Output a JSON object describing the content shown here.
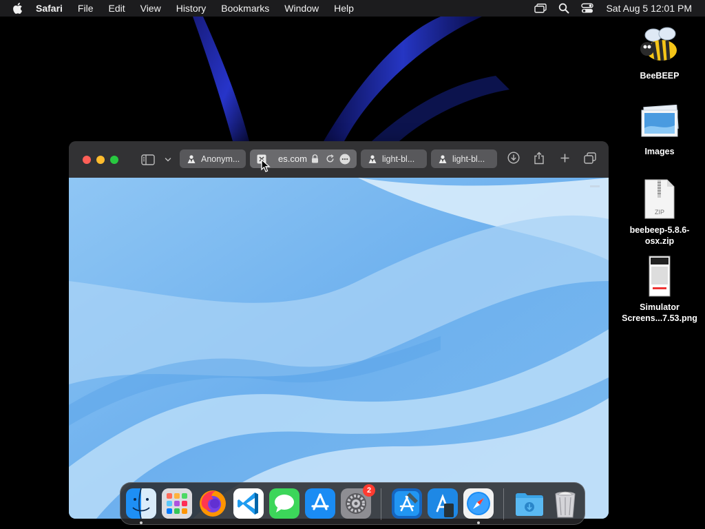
{
  "menubar": {
    "apple_icon": "apple-logo-icon",
    "app_name": "Safari",
    "items": [
      "File",
      "Edit",
      "View",
      "History",
      "Bookmarks",
      "Window",
      "Help"
    ],
    "status_icons": [
      "screen-mirroring-icon",
      "spotlight-search-icon",
      "control-center-icon"
    ],
    "clock": "Sat Aug 5  12:01 PM"
  },
  "desktop": {
    "icons": [
      {
        "label": "BeeBEEP",
        "icon": "bee-app-icon"
      },
      {
        "label": "Images",
        "icon": "image-folder-icon"
      },
      {
        "label_line1": "beebeep-5.8.6-",
        "label_line2": "osx.zip",
        "icon": "zip-file-icon",
        "type_text": "ZIP"
      },
      {
        "label_line1": "Simulator",
        "label_line2": "Screens...7.53.png",
        "icon": "png-file-icon"
      }
    ]
  },
  "safari": {
    "tabs": [
      {
        "label": "Anonym...",
        "icon": "favicon-person-icon",
        "active": false
      },
      {
        "label": "es.com",
        "icon": "close-tab-icon",
        "active": true
      },
      {
        "label": "light-bl...",
        "icon": "favicon-person-icon",
        "active": false
      },
      {
        "label": "light-bl...",
        "icon": "favicon-person-icon",
        "active": false
      }
    ],
    "toolbar_icons": [
      "sidebar-toggle-icon",
      "chevron-down-icon",
      "download-icon",
      "share-icon",
      "new-tab-icon",
      "tab-overview-icon"
    ],
    "page_content": "light-blue-wave-wallpaper"
  },
  "dock": {
    "apps": [
      {
        "name": "Finder",
        "icon": "finder-icon",
        "running": true
      },
      {
        "name": "Launchpad",
        "icon": "launchpad-icon",
        "running": false
      },
      {
        "name": "Firefox",
        "icon": "firefox-icon",
        "running": false
      },
      {
        "name": "Visual Studio Code",
        "icon": "vscode-icon",
        "running": false
      },
      {
        "name": "Messages",
        "icon": "messages-icon",
        "running": false
      },
      {
        "name": "App Store",
        "icon": "app-store-icon",
        "running": false
      },
      {
        "name": "System Settings",
        "icon": "system-settings-icon",
        "running": false,
        "badge": "2"
      },
      {
        "name": "Xcode",
        "icon": "xcode-icon",
        "running": false
      },
      {
        "name": "Simulator",
        "icon": "simulator-icon",
        "running": false
      },
      {
        "name": "Safari",
        "icon": "safari-icon",
        "running": true
      },
      {
        "name": "Downloads",
        "icon": "downloads-folder-icon",
        "running": false
      },
      {
        "name": "Trash",
        "icon": "trash-icon",
        "running": false
      }
    ]
  },
  "colors": {
    "menubar_bg": "#1c1c1e",
    "close": "#ff5f57",
    "minimize": "#febc2e",
    "zoom": "#28c840",
    "page_blue": "#6fb3ef",
    "badge_red": "#ff3b30"
  }
}
